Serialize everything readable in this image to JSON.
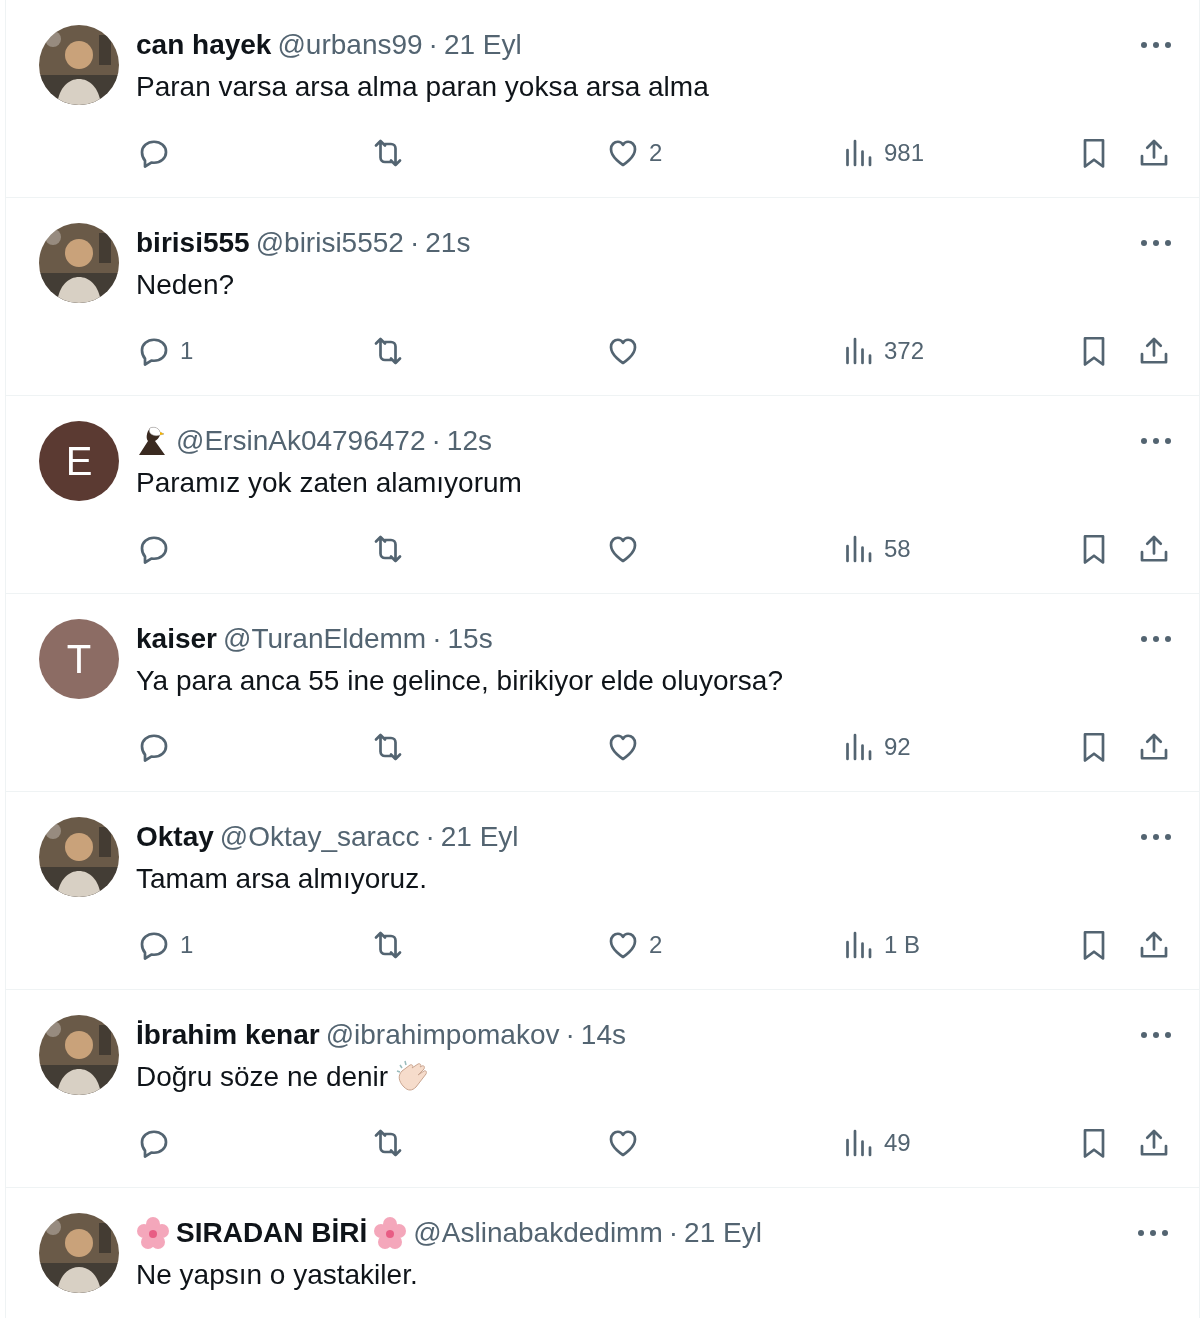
{
  "replies": [
    {
      "avatar": {
        "kind": "picture"
      },
      "name_parts": [
        {
          "kind": "text",
          "text": "can hayek"
        }
      ],
      "handle": "@urbans99",
      "separator": "·",
      "time": "21 Eyl",
      "text_parts": [
        {
          "kind": "text",
          "text": "Paran varsa arsa alma paran yoksa arsa alma"
        }
      ],
      "actions": {
        "likes": "2",
        "views": "981"
      }
    },
    {
      "avatar": {
        "kind": "picture"
      },
      "name_parts": [
        {
          "kind": "text",
          "text": "birisi555"
        }
      ],
      "handle": "@birisi5552",
      "separator": "·",
      "time": "21s",
      "text_parts": [
        {
          "kind": "text",
          "text": "Neden?"
        }
      ],
      "actions": {
        "replies": "1",
        "views": "372"
      }
    },
    {
      "avatar": {
        "kind": "letter",
        "letter": "E",
        "color": "#5b3a32"
      },
      "name_parts": [
        {
          "kind": "eagle"
        }
      ],
      "handle": "@ErsinAk04796472",
      "separator": "·",
      "time": "12s",
      "text_parts": [
        {
          "kind": "text",
          "text": "Paramız yok zaten alamıyorum"
        }
      ],
      "actions": {
        "views": "58"
      }
    },
    {
      "avatar": {
        "kind": "letter",
        "letter": "T",
        "color": "#8c6c64"
      },
      "name_parts": [
        {
          "kind": "text",
          "text": "kaiser"
        }
      ],
      "handle": "@TuranEldemm",
      "separator": "·",
      "time": "15s",
      "text_parts": [
        {
          "kind": "text",
          "text": "Ya para anca 55 ine gelince, birikiyor elde oluyorsa?"
        }
      ],
      "actions": {
        "views": "92"
      }
    },
    {
      "avatar": {
        "kind": "picture"
      },
      "name_parts": [
        {
          "kind": "text",
          "text": "Oktay"
        }
      ],
      "handle": "@Oktay_saracc",
      "separator": "·",
      "time": "21 Eyl",
      "text_parts": [
        {
          "kind": "text",
          "text": "Tamam arsa almıyoruz."
        }
      ],
      "actions": {
        "replies": "1",
        "likes": "2",
        "views": "1 B"
      }
    },
    {
      "avatar": {
        "kind": "picture"
      },
      "name_parts": [
        {
          "kind": "text",
          "text": "İbrahim kenar"
        }
      ],
      "handle": "@ibrahimpomakov",
      "separator": "·",
      "time": "14s",
      "text_parts": [
        {
          "kind": "text",
          "text": "Doğru söze ne denir"
        },
        {
          "kind": "clap"
        }
      ],
      "actions": {
        "views": "49"
      }
    },
    {
      "avatar": {
        "kind": "picture"
      },
      "name_parts": [
        {
          "kind": "flower"
        },
        {
          "kind": "text",
          "text": "SIRADAN BİRİ"
        },
        {
          "kind": "flower"
        }
      ],
      "handle": "@Aslinabakdedimm",
      "separator": "·",
      "time": "21 Eyl",
      "text_parts": [
        {
          "kind": "text",
          "text": "Ne yapsın o yastakiler."
        }
      ]
    }
  ]
}
